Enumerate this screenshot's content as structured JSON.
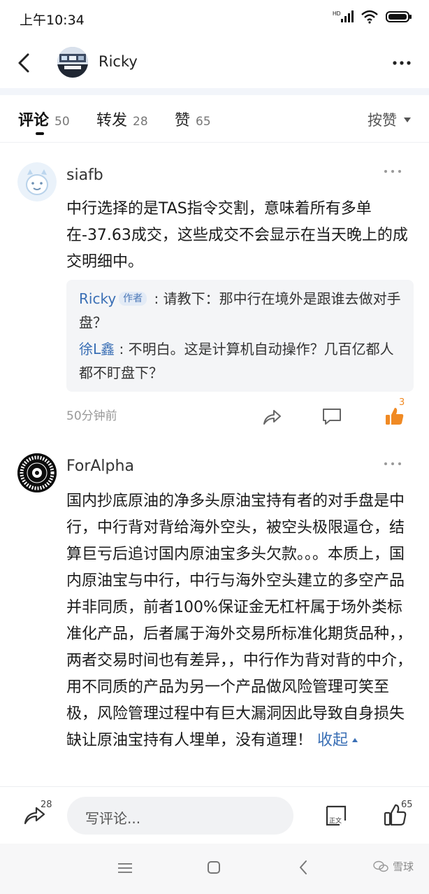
{
  "status_bar": {
    "time": "上午10:34",
    "network": "HD",
    "icons": [
      "signal-icon",
      "wifi-icon",
      "battery-icon"
    ]
  },
  "nav": {
    "title": "Ricky",
    "icons": [
      "back-icon",
      "more-icon"
    ]
  },
  "tabs": [
    {
      "label": "评论",
      "count": "50",
      "active": true
    },
    {
      "label": "转发",
      "count": "28",
      "active": false
    },
    {
      "label": "赞",
      "count": "65",
      "active": false
    }
  ],
  "sort": {
    "label": "按赞"
  },
  "comments": [
    {
      "user": "siafb",
      "text": "中行选择的是TAS指令交割，意味着所有多单在-37.63成交，这些成交不会显示在当天晚上的成交明细中。",
      "replies": [
        {
          "user": "Ricky",
          "tag": "作者",
          "sep": " : ",
          "text": "请教下：那中行在境外是跟谁去做对手盘？"
        },
        {
          "user": "徐L鑫",
          "sep": " : ",
          "text": "不明白。这是计算机自动操作？几百亿都人都不盯盘下？"
        }
      ],
      "time": "50分钟前",
      "likes": "3"
    },
    {
      "user": "ForAlpha",
      "text": "国内抄底原油的净多头原油宝持有者的对手盘是中行，中行背对背给海外空头，被空头极限逼仓，结算巨亏后追讨国内原油宝多头欠款。。。本质上，国内原油宝与中行，中行与海外空头建立的多空产品并非同质，前者100%保证金无杠杆属于场外类标准化产品，后者属于海外交易所标准化期货品种，，两者交易时间也有差异，，中行作为背对背的中介，用不同质的产品为另一个产品做风险管理可笑至极，风险管理过程中有巨大漏洞因此导致自身损失缺让原油宝持有人埋单，没有道理！",
      "collapse_label": "收起"
    }
  ],
  "bottom_bar": {
    "share_count": "28",
    "input_placeholder": "写评论...",
    "read_label": "正文",
    "like_count": "65"
  },
  "system_nav": {
    "watermark": "雪球"
  },
  "colors": {
    "link": "#3a6fb5",
    "like_active": "#f08a24",
    "reply_bg": "#f4f5f7"
  }
}
